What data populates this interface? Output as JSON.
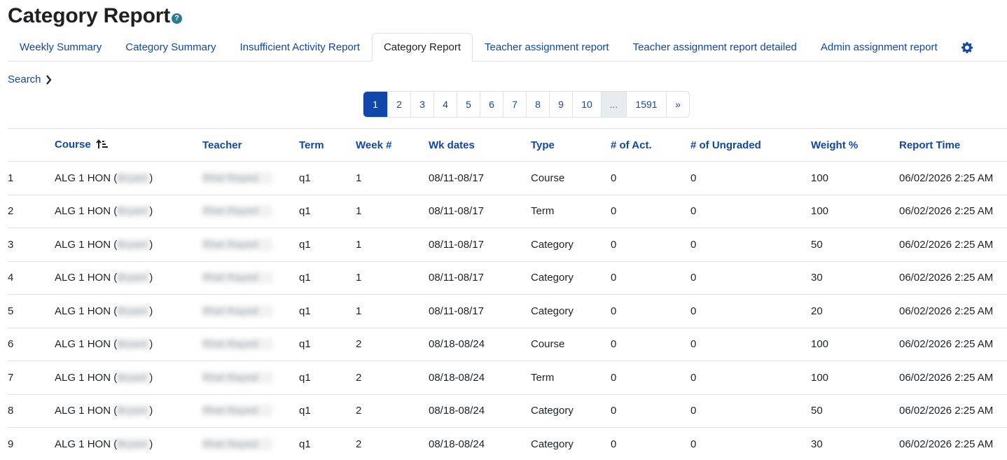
{
  "page": {
    "title": "Category Report",
    "help_icon": "?"
  },
  "tabs": [
    {
      "label": "Weekly Summary",
      "active": false
    },
    {
      "label": "Category Summary",
      "active": false
    },
    {
      "label": "Insufficient Activity Report",
      "active": false
    },
    {
      "label": "Category Report",
      "active": true
    },
    {
      "label": "Teacher assignment report",
      "active": false
    },
    {
      "label": "Teacher assignment report detailed",
      "active": false
    },
    {
      "label": "Admin assignment report",
      "active": false
    }
  ],
  "settings_icon": "gear-icon",
  "search": {
    "label": "Search",
    "icon": "chevron-right-icon"
  },
  "pagination": {
    "items": [
      "1",
      "2",
      "3",
      "4",
      "5",
      "6",
      "7",
      "8",
      "9",
      "10",
      "...",
      "1591",
      "»"
    ],
    "active": "1"
  },
  "table": {
    "columns": [
      "",
      "Course",
      "Teacher",
      "Term",
      "Week #",
      "Wk dates",
      "Type",
      "# of Act.",
      "# of Ungraded",
      "Weight %",
      "Report Time"
    ],
    "sort_column": "Course",
    "sort_icon": "sort-ascending-icon",
    "rows": [
      {
        "n": "1",
        "course": "ALG 1 HON (",
        "course_blur": "Bryant",
        "course_end": ")",
        "teacher": "Rhet Rayed",
        "term": "q1",
        "week": "1",
        "dates": "08/11-08/17",
        "type": "Course",
        "acts": "0",
        "ungraded": "0",
        "weight": "100",
        "time": "06/02/2026 2:25 AM"
      },
      {
        "n": "2",
        "course": "ALG 1 HON (",
        "course_blur": "Bryant",
        "course_end": ")",
        "teacher": "Rhet Rayed",
        "term": "q1",
        "week": "1",
        "dates": "08/11-08/17",
        "type": "Term",
        "acts": "0",
        "ungraded": "0",
        "weight": "100",
        "time": "06/02/2026 2:25 AM"
      },
      {
        "n": "3",
        "course": "ALG 1 HON (",
        "course_blur": "Bryant",
        "course_end": ")",
        "teacher": "Rhet Rayed",
        "term": "q1",
        "week": "1",
        "dates": "08/11-08/17",
        "type": "Category",
        "acts": "0",
        "ungraded": "0",
        "weight": "50",
        "time": "06/02/2026 2:25 AM"
      },
      {
        "n": "4",
        "course": "ALG 1 HON (",
        "course_blur": "Bryant",
        "course_end": ")",
        "teacher": "Rhet Rayed",
        "term": "q1",
        "week": "1",
        "dates": "08/11-08/17",
        "type": "Category",
        "acts": "0",
        "ungraded": "0",
        "weight": "30",
        "time": "06/02/2026 2:25 AM"
      },
      {
        "n": "5",
        "course": "ALG 1 HON (",
        "course_blur": "Bryant",
        "course_end": ")",
        "teacher": "Rhet Rayed",
        "term": "q1",
        "week": "1",
        "dates": "08/11-08/17",
        "type": "Category",
        "acts": "0",
        "ungraded": "0",
        "weight": "20",
        "time": "06/02/2026 2:25 AM"
      },
      {
        "n": "6",
        "course": "ALG 1 HON (",
        "course_blur": "Bryant",
        "course_end": ")",
        "teacher": "Rhet Rayed",
        "term": "q1",
        "week": "2",
        "dates": "08/18-08/24",
        "type": "Course",
        "acts": "0",
        "ungraded": "0",
        "weight": "100",
        "time": "06/02/2026 2:25 AM"
      },
      {
        "n": "7",
        "course": "ALG 1 HON (",
        "course_blur": "Bryant",
        "course_end": ")",
        "teacher": "Rhet Rayed",
        "term": "q1",
        "week": "2",
        "dates": "08/18-08/24",
        "type": "Term",
        "acts": "0",
        "ungraded": "0",
        "weight": "100",
        "time": "06/02/2026 2:25 AM"
      },
      {
        "n": "8",
        "course": "ALG 1 HON (",
        "course_blur": "Bryant",
        "course_end": ")",
        "teacher": "Rhet Rayed",
        "term": "q1",
        "week": "2",
        "dates": "08/18-08/24",
        "type": "Category",
        "acts": "0",
        "ungraded": "0",
        "weight": "50",
        "time": "06/02/2026 2:25 AM"
      },
      {
        "n": "9",
        "course": "ALG 1 HON (",
        "course_blur": "Bryant",
        "course_end": ")",
        "teacher": "Rhet Rayed",
        "term": "q1",
        "week": "2",
        "dates": "08/18-08/24",
        "type": "Category",
        "acts": "0",
        "ungraded": "0",
        "weight": "30",
        "time": "06/02/2026 2:25 AM"
      }
    ]
  }
}
